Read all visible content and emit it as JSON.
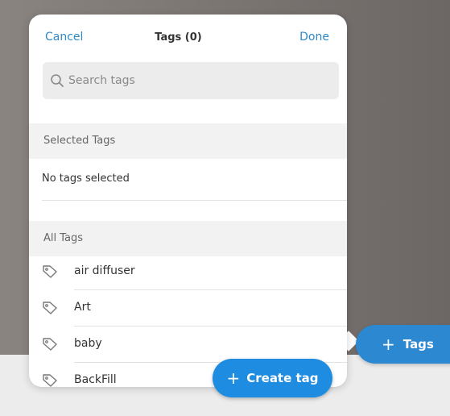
{
  "header": {
    "cancel_label": "Cancel",
    "title": "Tags (0)",
    "done_label": "Done"
  },
  "search": {
    "placeholder": "Search tags"
  },
  "selected_section": {
    "title": "Selected Tags",
    "empty_text": "No tags selected"
  },
  "all_section": {
    "title": "All Tags",
    "items": [
      {
        "label": "air diffuser",
        "icon": "tag-icon"
      },
      {
        "label": "Art",
        "icon": "tag-icon"
      },
      {
        "label": "baby",
        "icon": "tag-icon"
      },
      {
        "label": "BackFill",
        "icon": "tag-icon"
      }
    ]
  },
  "create_tag_button": {
    "icon": "plus-icon",
    "label": "Create tag"
  },
  "tags_button": {
    "icon": "plus-icon",
    "label": "Tags"
  },
  "colors": {
    "accent": "#1e8ce0",
    "link": "#2f89c6",
    "section_bg": "#f2f2f2"
  }
}
